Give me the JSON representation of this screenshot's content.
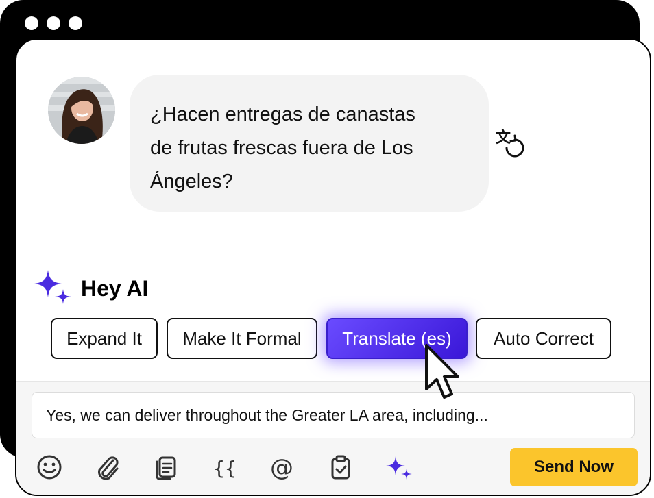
{
  "window": {
    "dots": 3
  },
  "message": {
    "lines": [
      "¿Hacen entregas de canastas",
      "de frutas frescas fuera de Los",
      "Ángeles?"
    ]
  },
  "ai": {
    "title": "Hey AI",
    "actions": [
      {
        "label": "Expand It",
        "active": false
      },
      {
        "label": "Make It Formal",
        "active": false
      },
      {
        "label": "Translate (es)",
        "active": true
      },
      {
        "label": "Auto Correct",
        "active": false
      }
    ]
  },
  "composer": {
    "value": "Yes, we can deliver throughout the Greater LA area, including..."
  },
  "toolbar": {
    "icons": [
      "emoji-icon",
      "paperclip-icon",
      "document-icon",
      "curly-braces-icon",
      "at-sign-icon",
      "clipboard-check-icon",
      "sparkle-icon"
    ],
    "send_label": "Send Now"
  },
  "colors": {
    "accent": "#4a2be0",
    "send": "#fbc52c",
    "bubble": "#f3f3f3"
  }
}
